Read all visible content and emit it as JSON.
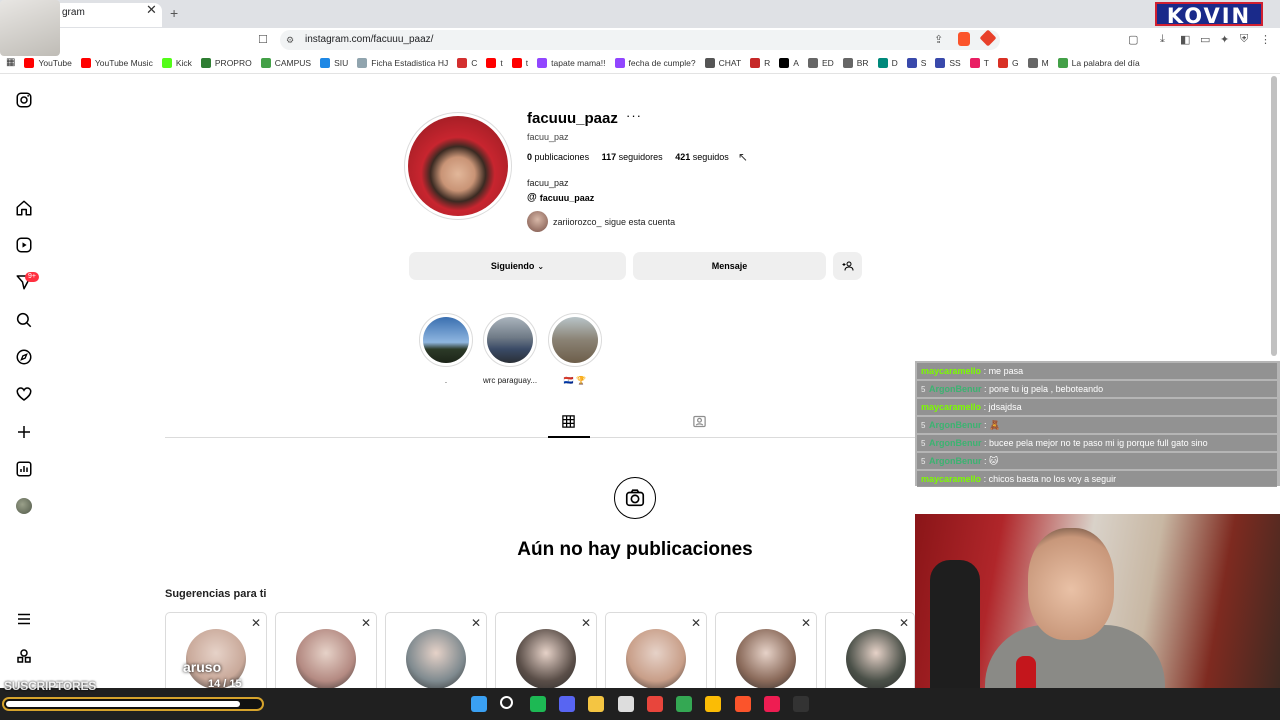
{
  "browser": {
    "tab_title": "gram",
    "url": "instagram.com/facuuu_paaz/",
    "bookmarks": [
      {
        "label": "YouTube",
        "color": "#ff0000"
      },
      {
        "label": "YouTube Music",
        "color": "#ff0000"
      },
      {
        "label": "Kick",
        "color": "#53fc18"
      },
      {
        "label": "PROPRO",
        "color": "#2e7d32"
      },
      {
        "label": "CAMPUS",
        "color": "#43a047"
      },
      {
        "label": "SIU",
        "color": "#1e88e5"
      },
      {
        "label": "Ficha Estadistica HJ",
        "color": "#90a4ae"
      },
      {
        "label": "C",
        "color": "#d32f2f"
      },
      {
        "label": "t",
        "color": "#ff0000"
      },
      {
        "label": "t",
        "color": "#ff0000"
      },
      {
        "label": "tapate mama!!",
        "color": "#9146ff"
      },
      {
        "label": "fecha de cumple?",
        "color": "#9146ff"
      },
      {
        "label": "CHAT",
        "color": "#555555"
      },
      {
        "label": "R",
        "color": "#c62828"
      },
      {
        "label": "A",
        "color": "#000000"
      },
      {
        "label": "ED",
        "color": "#666666"
      },
      {
        "label": "BR",
        "color": "#666666"
      },
      {
        "label": "D",
        "color": "#00897b"
      },
      {
        "label": "S",
        "color": "#3949ab"
      },
      {
        "label": "SS",
        "color": "#3949ab"
      },
      {
        "label": "T",
        "color": "#e91e63"
      },
      {
        "label": "G",
        "color": "#d93025"
      },
      {
        "label": "M",
        "color": "#666666"
      },
      {
        "label": "La palabra del día",
        "color": "#43a047"
      }
    ]
  },
  "overlay": {
    "logo": "KOVIN",
    "subs_label": "SUSCRIPTORES",
    "subs_name": "aruso",
    "subs_count": "14 / 15",
    "subs_progress": 0.93
  },
  "sidebar": {
    "notif_badge": "9+"
  },
  "profile": {
    "username": "facuuu_paaz",
    "handle": "facuu_paz",
    "posts_count": "0",
    "posts_label": "publicaciones",
    "followers_count": "117",
    "followers_label": "seguidores",
    "following_count": "421",
    "following_label": "seguidos",
    "bio_name": "facuu_paz",
    "threads_handle": "facuuu_paaz",
    "followed_by_user": "zariiorozco_",
    "followed_by_text": "sigue esta cuenta",
    "btn_following": "Siguiendo",
    "btn_message": "Mensaje"
  },
  "highlights": [
    {
      "label": ".",
      "color": "#3a6fb0"
    },
    {
      "label": "wrc paraguay...",
      "color": "#6f7a86"
    },
    {
      "label": "🇵🇾 🏆",
      "color": "#8a8274"
    }
  ],
  "empty_state": {
    "title": "Aún no hay publicaciones"
  },
  "suggestions": {
    "title": "Sugerencias para ti",
    "cards": [
      {
        "color": "#c9a99a"
      },
      {
        "color": "#b48a82"
      },
      {
        "color": "#7f8a8f"
      },
      {
        "color": "#5a4e48"
      },
      {
        "color": "#c89e88"
      },
      {
        "color": "#8a6a5a"
      },
      {
        "color": "#4a5048"
      }
    ]
  },
  "chat": [
    {
      "user": "maycaramello",
      "color": "#7cfc00",
      "badge": "",
      "msg": ": me pasa"
    },
    {
      "user": "ArgonBenur",
      "color": "#3cb371",
      "badge": "5",
      "msg": ": pone tu ig pela , beboteando"
    },
    {
      "user": "maycaramello",
      "color": "#7cfc00",
      "badge": "",
      "msg": ": jdsajdsa"
    },
    {
      "user": "ArgonBenur",
      "color": "#3cb371",
      "badge": "5",
      "msg": ": 🧸"
    },
    {
      "user": "ArgonBenur",
      "color": "#3cb371",
      "badge": "5",
      "msg": ": bucee pela mejor no te paso mi ig porque full gato sino"
    },
    {
      "user": "ArgonBenur",
      "color": "#3cb371",
      "badge": "5",
      "msg": ": 🐱"
    },
    {
      "user": "maycaramello",
      "color": "#7cfc00",
      "badge": "",
      "msg": ": chicos basta no los voy a seguir"
    }
  ]
}
